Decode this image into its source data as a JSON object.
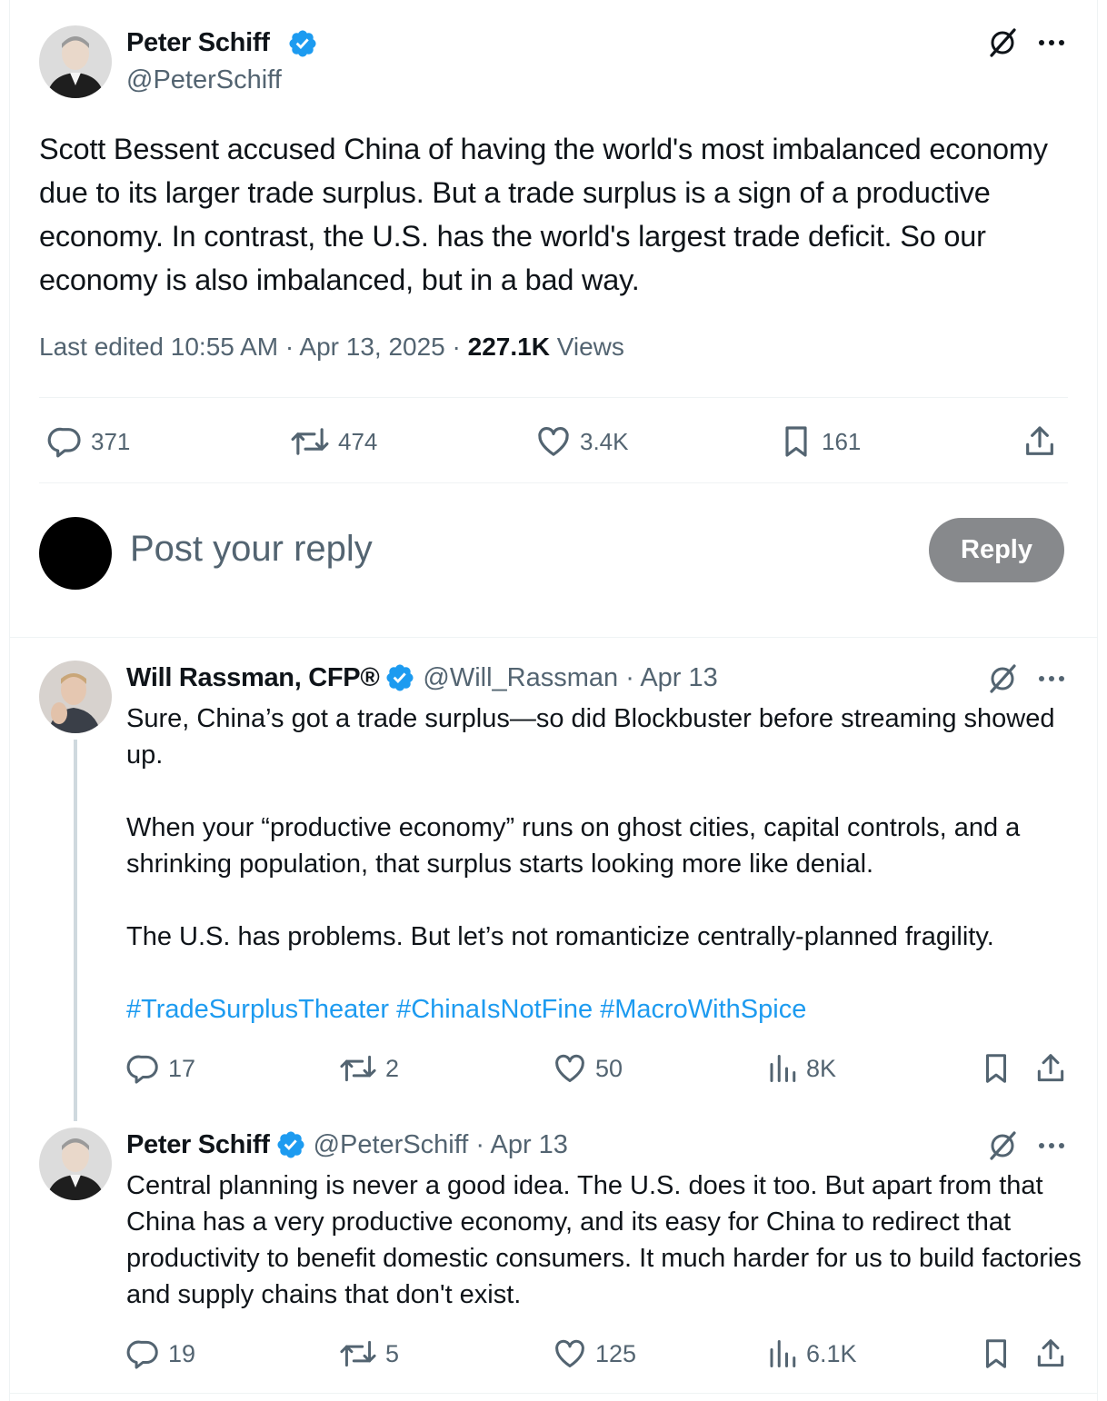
{
  "main_post": {
    "author_name": "Peter Schiff",
    "handle": "@PeterSchiff",
    "text": "Scott Bessent accused China of having the world's most imbalanced economy due to its larger trade surplus. But a trade surplus is a sign of a productive economy. In contrast, the U.S. has the world's largest trade deficit. So our economy is also imbalanced, but in a bad way.",
    "edited_label": "Last edited 10:55 AM · Apr 13, 2025 · ",
    "views_count": "227.1K",
    "views_label": " Views",
    "stats": {
      "replies": "371",
      "reposts": "474",
      "likes": "3.4K",
      "bookmarks": "161"
    }
  },
  "composer": {
    "placeholder": "Post your reply",
    "button_label": "Reply"
  },
  "replies": [
    {
      "author_name": "Will Rassman, CFP®",
      "handle": "@Will_Rassman · Apr 13",
      "paragraphs": [
        "Sure, China’s got a trade surplus—so did Blockbuster before streaming showed up.",
        "When your “productive economy” runs on ghost cities, capital controls, and a shrinking population, that surplus starts looking more like denial.",
        "The U.S. has problems. But let’s not romanticize centrally-planned fragility."
      ],
      "hashtags": [
        "#TradeSurplusTheater",
        "#ChinaIsNotFine",
        "#MacroWithSpice"
      ],
      "stats": {
        "replies": "17",
        "reposts": "2",
        "likes": "50",
        "views": "8K"
      }
    },
    {
      "author_name": "Peter Schiff",
      "handle": "@PeterSchiff · Apr 13",
      "text": "Central planning is never a good idea. The U.S. does it too. But apart from that China has a very productive economy, and its easy for China to redirect that productivity to benefit domestic consumers. It much harder for us to build factories and supply chains that don't exist.",
      "stats": {
        "replies": "19",
        "reposts": "5",
        "likes": "125",
        "views": "6.1K"
      }
    }
  ],
  "colors": {
    "accent": "#1d9bf0",
    "secondary_text": "#536471",
    "reply_button": "#87898c"
  }
}
